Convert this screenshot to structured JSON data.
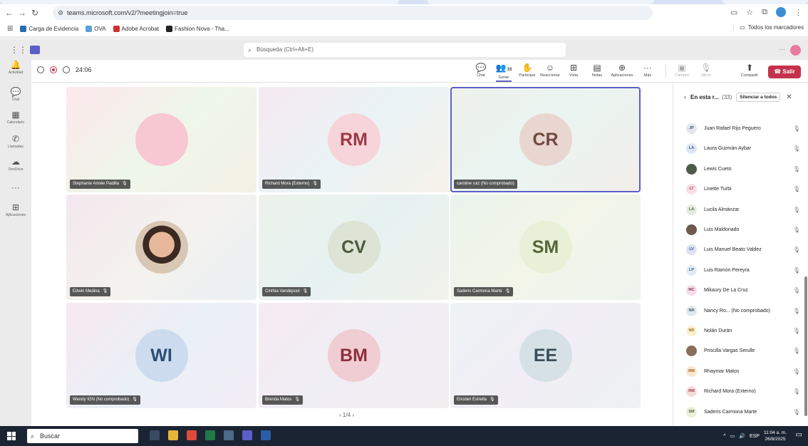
{
  "browser": {
    "url": "teams.microsoft.com/v2/?meetingjoin=true",
    "bookmarks": [
      {
        "label": "Carga de Evidencia",
        "color": "#2b6cb0"
      },
      {
        "label": "OVA",
        "color": "#5aa0d8"
      },
      {
        "label": "Adobe Acrobat",
        "color": "#d32f2f"
      },
      {
        "label": "Fashion Nova - Tha...",
        "color": "#222222"
      }
    ],
    "all_bookmarks": "Todos los marcadores"
  },
  "teams": {
    "search_placeholder": "Búsqueda (Ctrl+Alt+E)",
    "rail": [
      {
        "label": "Actividad",
        "icon": "bell-icon",
        "glyph": "🔔"
      },
      {
        "label": "Chat",
        "icon": "chat-icon",
        "glyph": "💬"
      },
      {
        "label": "Calendario",
        "icon": "calendar-icon",
        "glyph": "▦"
      },
      {
        "label": "Llamadas",
        "icon": "phone-icon",
        "glyph": "✆"
      },
      {
        "label": "OneDrive",
        "icon": "cloud-icon",
        "glyph": "☁"
      },
      {
        "label": "",
        "icon": "more-icon",
        "glyph": "···"
      },
      {
        "label": "Aplicaciones",
        "icon": "apps-add-icon",
        "glyph": "⊞"
      }
    ]
  },
  "meeting": {
    "timer": "24:06",
    "toolbar": [
      {
        "label": "Chat",
        "glyph": "💬",
        "name": "chat-tool",
        "icon": "chat-icon"
      },
      {
        "label": "Gente",
        "glyph": "👥",
        "badge": "33",
        "name": "people-tool",
        "icon": "people-icon",
        "active": true
      },
      {
        "label": "Participar",
        "glyph": "✋",
        "name": "raise-hand-tool",
        "icon": "hand-icon"
      },
      {
        "label": "Reaccionar",
        "glyph": "☺",
        "name": "react-tool",
        "icon": "smile-icon"
      },
      {
        "label": "Vista",
        "glyph": "⊞",
        "name": "view-tool",
        "icon": "grid-icon"
      },
      {
        "label": "Notas",
        "glyph": "▤",
        "name": "notes-tool",
        "icon": "notes-icon"
      },
      {
        "label": "Aplicaciones",
        "glyph": "⊕",
        "name": "apps-tool",
        "icon": "apps-icon"
      },
      {
        "label": "Más",
        "glyph": "···",
        "name": "more-tool",
        "icon": "more-icon"
      }
    ],
    "controls": [
      {
        "label": "Cámara",
        "glyph": "▣",
        "name": "camera-tool",
        "icon": "camera-off-icon"
      },
      {
        "label": "Micró",
        "glyph": "🎙",
        "name": "mic-tool",
        "icon": "mic-off-icon"
      },
      {
        "label": "Compartir",
        "glyph": "⬆",
        "name": "share-tool",
        "icon": "share-icon"
      }
    ],
    "leave_label": "Salir",
    "tiles": [
      {
        "name": "Stephanie Aimée Padilla",
        "initials": "",
        "bg": "#f7c7d2",
        "fg": "#a23a55",
        "tint": "linear-gradient(135deg,#fde8ec,#eef6ea,#f3f1e6)"
      },
      {
        "name": "Richard Mora (Externo)",
        "initials": "RM",
        "bg": "#f7d4d9",
        "fg": "#9b3a45",
        "tint": "linear-gradient(135deg,#f5eaf0,#eaf3f6,#f6f2e8)"
      },
      {
        "name": "caroline ruiz (No comprobado)",
        "initials": "CR",
        "bg": "#ead6d0",
        "fg": "#6f4a40",
        "tint": "linear-gradient(135deg,#eef1ea,#eaf5f2,#f3eee9)",
        "selected": true
      },
      {
        "name": "Edwin Medina",
        "initials": "",
        "photo": true,
        "bg": "#d9c7b5",
        "fg": "#333",
        "tint": "linear-gradient(135deg,#f3e8ee,#f4f2ee,#eaf0f4)"
      },
      {
        "name": "Cinthia Vandepool",
        "initials": "CV",
        "bg": "#dde3d5",
        "fg": "#4a5a3e",
        "tint": "linear-gradient(135deg,#edf2ea,#e6f2f1,#f2f2ea)"
      },
      {
        "name": "Saderis Carmona Marte",
        "initials": "SM",
        "bg": "#e8f0d7",
        "fg": "#55663a",
        "tint": "linear-gradient(135deg,#eaf4ec,#f2f5e8,#eef3ee)"
      },
      {
        "name": "Wendy IGN (No comprobado)",
        "initials": "WI",
        "bg": "#ccdcee",
        "fg": "#2d4d76",
        "tint": "linear-gradient(135deg,#f7e9ef,#eaf0f7,#f3eef5)"
      },
      {
        "name": "Brenda Matos",
        "initials": "BM",
        "bg": "#f0cdd3",
        "fg": "#8e2f3c",
        "tint": "linear-gradient(135deg,#f5ebf0,#f0eef5,#f3eef0)"
      },
      {
        "name": "Ericden Estrella",
        "initials": "EE",
        "bg": "#d6e1e6",
        "fg": "#3a4e58",
        "tint": "linear-gradient(135deg,#edf3f5,#f1eef5,#eef2f3)"
      }
    ],
    "pager": "1/4",
    "panel": {
      "title": "En esta r...",
      "count": "(33)",
      "mute_all": "Silenciar a todos",
      "people": [
        {
          "initials": "JP",
          "name": "Juan Rafael Rijo Peguero",
          "bg": "#e3e6ee",
          "fg": "#4a5470"
        },
        {
          "initials": "LA",
          "name": "Laura Guzmán Aybar",
          "bg": "#dbe6f2",
          "fg": "#3d5a80"
        },
        {
          "initials": "",
          "name": "Lewis Cueto",
          "bg": "#4d5a49",
          "fg": "#fff",
          "photo": true
        },
        {
          "initials": "LT",
          "name": "Linette Turbi",
          "bg": "#f8dfe3",
          "fg": "#a23a55"
        },
        {
          "initials": "LA",
          "name": "Lucila Almánzar",
          "bg": "#e4ebdf",
          "fg": "#56684a"
        },
        {
          "initials": "",
          "name": "Luis Maldonado",
          "bg": "#6d5a4a",
          "fg": "#fff",
          "photo": true
        },
        {
          "initials": "LV",
          "name": "Luis Manuel Beato Valdez",
          "bg": "#dfe2f3",
          "fg": "#3f4a8a"
        },
        {
          "initials": "LP",
          "name": "Luis Ramón Pereyra",
          "bg": "#e1ebf5",
          "fg": "#3f5f85"
        },
        {
          "initials": "MC",
          "name": "Mikaury De La Cruz",
          "bg": "#f4dde6",
          "fg": "#8e3a5e"
        },
        {
          "initials": "NR",
          "name": "Nancy Ro...  (No comprobado)",
          "bg": "#e0e8ee",
          "fg": "#3f5868"
        },
        {
          "initials": "ND",
          "name": "Nolán Durán",
          "bg": "#fbf0cf",
          "fg": "#8a6a10"
        },
        {
          "initials": "",
          "name": "Priscilla Vargas Serulle",
          "bg": "#8a6e5c",
          "fg": "#fff",
          "photo": true
        },
        {
          "initials": "RM",
          "name": "Rhaymar Matos",
          "bg": "#fbe6cf",
          "fg": "#9a5c1a"
        },
        {
          "initials": "RM",
          "name": "Richard Mora (Externo)",
          "bg": "#f7dadd",
          "fg": "#9b3a45"
        },
        {
          "initials": "SM",
          "name": "Saderis Carmona Marte",
          "bg": "#e8f0d7",
          "fg": "#55663a"
        }
      ]
    }
  },
  "taskbar": {
    "search_placeholder": "Buscar",
    "apps": [
      {
        "name": "task-view-icon",
        "color": "#3a4a63"
      },
      {
        "name": "file-explorer-icon",
        "color": "#e8b43a"
      },
      {
        "name": "chrome-icon",
        "color": "#e04a3c"
      },
      {
        "name": "excel-icon",
        "color": "#1f7a45"
      },
      {
        "name": "calculator-icon",
        "color": "#4a6b8a"
      },
      {
        "name": "teams-icon",
        "color": "#5b5fc7"
      },
      {
        "name": "word-icon",
        "color": "#2b5ca8"
      }
    ],
    "lang": "ESP",
    "time": "11:04 a. m.",
    "date": "26/8/2025"
  }
}
